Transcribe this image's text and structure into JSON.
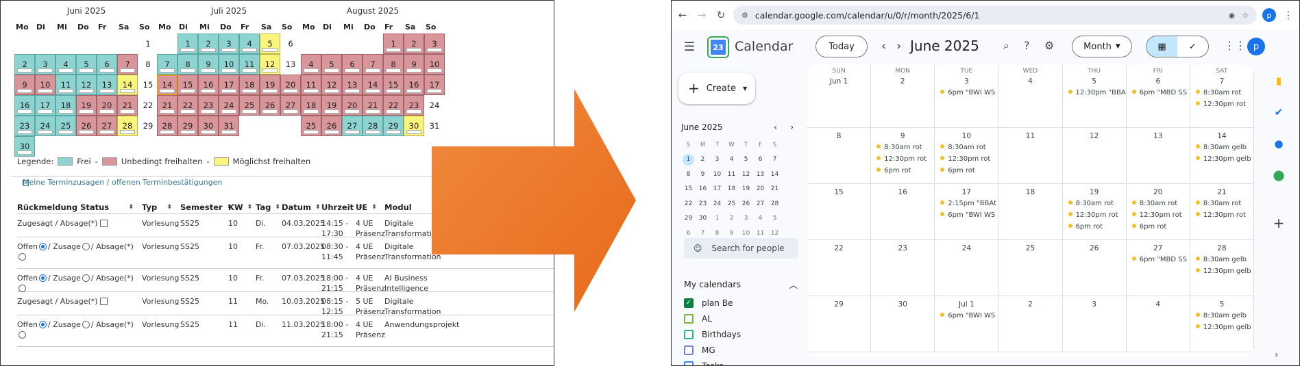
{
  "left": {
    "months": [
      {
        "title": "Juni 2025",
        "days": [
          "Mo",
          "Di",
          "Mi",
          "Do",
          "Fr",
          "Sa",
          "So"
        ],
        "cells": [
          {
            "d": "",
            "s": ""
          },
          {
            "d": "",
            "s": ""
          },
          {
            "d": "",
            "s": ""
          },
          {
            "d": "",
            "s": ""
          },
          {
            "d": "",
            "s": ""
          },
          {
            "d": "",
            "s": ""
          },
          {
            "d": "1",
            "s": ""
          },
          {
            "d": "2",
            "s": "f"
          },
          {
            "d": "3",
            "s": "f"
          },
          {
            "d": "4",
            "s": "f"
          },
          {
            "d": "5",
            "s": "f"
          },
          {
            "d": "6",
            "s": "f"
          },
          {
            "d": "7",
            "s": "u"
          },
          {
            "d": "8",
            "s": ""
          },
          {
            "d": "9",
            "s": "u"
          },
          {
            "d": "10",
            "s": "u"
          },
          {
            "d": "11",
            "s": "f"
          },
          {
            "d": "12",
            "s": "f"
          },
          {
            "d": "13",
            "s": "f"
          },
          {
            "d": "14",
            "s": "m"
          },
          {
            "d": "15",
            "s": ""
          },
          {
            "d": "16",
            "s": "f"
          },
          {
            "d": "17",
            "s": "f"
          },
          {
            "d": "18",
            "s": "f"
          },
          {
            "d": "19",
            "s": "u"
          },
          {
            "d": "20",
            "s": "u"
          },
          {
            "d": "21",
            "s": "u"
          },
          {
            "d": "22",
            "s": ""
          },
          {
            "d": "23",
            "s": "f"
          },
          {
            "d": "24",
            "s": "f"
          },
          {
            "d": "25",
            "s": "f"
          },
          {
            "d": "26",
            "s": "u"
          },
          {
            "d": "27",
            "s": "u"
          },
          {
            "d": "28",
            "s": "m"
          },
          {
            "d": "29",
            "s": ""
          },
          {
            "d": "30",
            "s": "f"
          }
        ]
      },
      {
        "title": "Juli 2025",
        "days": [
          "Mo",
          "Di",
          "Mi",
          "Do",
          "Fr",
          "Sa",
          "So"
        ],
        "cells": [
          {
            "d": "",
            "s": ""
          },
          {
            "d": "1",
            "s": "f"
          },
          {
            "d": "2",
            "s": "f"
          },
          {
            "d": "3",
            "s": "f"
          },
          {
            "d": "4",
            "s": "f"
          },
          {
            "d": "5",
            "s": "m"
          },
          {
            "d": "6",
            "s": ""
          },
          {
            "d": "7",
            "s": "f"
          },
          {
            "d": "8",
            "s": "f"
          },
          {
            "d": "9",
            "s": "f"
          },
          {
            "d": "10",
            "s": "f"
          },
          {
            "d": "11",
            "s": "f"
          },
          {
            "d": "12",
            "s": "m"
          },
          {
            "d": "13",
            "s": ""
          },
          {
            "d": "14",
            "s": "u",
            "sel": true
          },
          {
            "d": "15",
            "s": "u"
          },
          {
            "d": "16",
            "s": "u"
          },
          {
            "d": "17",
            "s": "u"
          },
          {
            "d": "18",
            "s": "u"
          },
          {
            "d": "19",
            "s": "u"
          },
          {
            "d": "20",
            "s": "u"
          },
          {
            "d": "21",
            "s": "u"
          },
          {
            "d": "22",
            "s": "u"
          },
          {
            "d": "23",
            "s": "u"
          },
          {
            "d": "24",
            "s": "u"
          },
          {
            "d": "25",
            "s": "u"
          },
          {
            "d": "26",
            "s": "u"
          },
          {
            "d": "27",
            "s": "u"
          },
          {
            "d": "28",
            "s": "u"
          },
          {
            "d": "29",
            "s": "u"
          },
          {
            "d": "30",
            "s": "u"
          },
          {
            "d": "31",
            "s": "u"
          }
        ]
      },
      {
        "title": "August 2025",
        "days": [
          "Mo",
          "Di",
          "Mi",
          "Do",
          "Fr",
          "Sa",
          "So"
        ],
        "cells": [
          {
            "d": "",
            "s": ""
          },
          {
            "d": "",
            "s": ""
          },
          {
            "d": "",
            "s": ""
          },
          {
            "d": "",
            "s": ""
          },
          {
            "d": "1",
            "s": "u"
          },
          {
            "d": "2",
            "s": "u"
          },
          {
            "d": "3",
            "s": "u"
          },
          {
            "d": "4",
            "s": "u"
          },
          {
            "d": "5",
            "s": "u"
          },
          {
            "d": "6",
            "s": "u"
          },
          {
            "d": "7",
            "s": "u"
          },
          {
            "d": "8",
            "s": "u"
          },
          {
            "d": "9",
            "s": "u"
          },
          {
            "d": "10",
            "s": "u"
          },
          {
            "d": "11",
            "s": "u"
          },
          {
            "d": "12",
            "s": "u"
          },
          {
            "d": "13",
            "s": "u"
          },
          {
            "d": "14",
            "s": "u"
          },
          {
            "d": "15",
            "s": "u"
          },
          {
            "d": "16",
            "s": "u"
          },
          {
            "d": "17",
            "s": "u"
          },
          {
            "d": "18",
            "s": "u"
          },
          {
            "d": "19",
            "s": "u"
          },
          {
            "d": "20",
            "s": "u"
          },
          {
            "d": "21",
            "s": "u"
          },
          {
            "d": "22",
            "s": "u"
          },
          {
            "d": "23",
            "s": "u"
          },
          {
            "d": "24",
            "s": ""
          },
          {
            "d": "25",
            "s": "u"
          },
          {
            "d": "26",
            "s": "u"
          },
          {
            "d": "27",
            "s": "f"
          },
          {
            "d": "28",
            "s": "f"
          },
          {
            "d": "29",
            "s": "f"
          },
          {
            "d": "30",
            "s": "m"
          },
          {
            "d": "31",
            "s": ""
          }
        ]
      }
    ],
    "legend": {
      "label": "Legende:",
      "frei": "Frei",
      "unbedingt": "Unbedingt freihalten",
      "moeglichst": "Möglichst freihalten",
      "sep": "-",
      "colors": {
        "frei": "#8dd3d0",
        "unbedingt": "#d8959a",
        "moeglichst": "#fbf57e"
      }
    },
    "section_title": "Meine Terminzusagen / offenen Terminbestätigungen",
    "table": {
      "headers": [
        "Rückmeldung Status",
        "Typ",
        "Semester",
        "KW",
        "Tag",
        "Datum",
        "Uhrzeit",
        "UE",
        "Modul"
      ],
      "rows": [
        {
          "status_type": "zugesagt",
          "status": "Zugesagt / Absage(*)",
          "typ": "Vorlesung",
          "semester": "SS25",
          "kw": "10",
          "tag": "Di.",
          "datum": "04.03.2025",
          "zeit1": "14:15 -",
          "zeit2": "17:30",
          "ue1": "4 UE",
          "ue2": "Präsenz",
          "modul1": "Digitale",
          "modul2": "Transformation"
        },
        {
          "status_type": "offen",
          "offen": "Offen",
          "zusage": "/ Zusage",
          "absage": "/ Absage(*)",
          "typ": "Vorlesung",
          "semester": "SS25",
          "kw": "10",
          "tag": "Fr.",
          "datum": "07.03.2025",
          "zeit1": "08:30 -",
          "zeit2": "11:45",
          "ue1": "4 UE",
          "ue2": "Präsenz",
          "modul1": "Digitale",
          "modul2": "Transformation"
        },
        {
          "status_type": "offen",
          "offen": "Offen",
          "zusage": "/ Zusage",
          "absage": "/ Absage(*)",
          "typ": "Vorlesung",
          "semester": "SS25",
          "kw": "10",
          "tag": "Fr.",
          "datum": "07.03.2025",
          "zeit1": "18:00 -",
          "zeit2": "21:15",
          "ue1": "4 UE",
          "ue2": "Präsenz",
          "modul1": "AI Business",
          "modul2": "Intelligence"
        },
        {
          "status_type": "zugesagt",
          "status": "Zugesagt / Absage(*)",
          "typ": "Vorlesung",
          "semester": "SS25",
          "kw": "11",
          "tag": "Mo.",
          "datum": "10.03.2025",
          "zeit1": "08:15 -",
          "zeit2": "12:15",
          "ue1": "5 UE",
          "ue2": "Präsenz",
          "modul1": "Digitale",
          "modul2": "Transformation"
        },
        {
          "status_type": "offen",
          "offen": "Offen",
          "zusage": "/ Zusage",
          "absage": "/ Absage(*)",
          "typ": "Vorlesung",
          "semester": "SS25",
          "kw": "11",
          "tag": "Di.",
          "datum": "11.03.2025",
          "zeit1": "18:00 -",
          "zeit2": "21:15",
          "ue1": "4 UE",
          "ue2": "Präsenz",
          "modul1": "Anwendungsprojekt",
          "modul2": ""
        }
      ]
    }
  },
  "arrow_color": "#ee7b2f",
  "right": {
    "url": "calendar.google.com/calendar/u/0/r/month/2025/6/1",
    "profile_initial": "p",
    "app_name": "Calendar",
    "logo_text": "23",
    "today_label": "Today",
    "current_month": "June 2025",
    "view_label": "Month",
    "create_label": "Create",
    "mini": {
      "title": "June 2025",
      "dows": [
        "S",
        "M",
        "T",
        "W",
        "T",
        "F",
        "S"
      ],
      "days": [
        {
          "d": "1",
          "c": "today"
        },
        {
          "d": "2"
        },
        {
          "d": "3"
        },
        {
          "d": "4"
        },
        {
          "d": "5"
        },
        {
          "d": "6"
        },
        {
          "d": "7"
        },
        {
          "d": "8"
        },
        {
          "d": "9"
        },
        {
          "d": "10"
        },
        {
          "d": "11"
        },
        {
          "d": "12"
        },
        {
          "d": "13"
        },
        {
          "d": "14"
        },
        {
          "d": "15"
        },
        {
          "d": "16"
        },
        {
          "d": "17"
        },
        {
          "d": "18"
        },
        {
          "d": "19"
        },
        {
          "d": "20"
        },
        {
          "d": "21"
        },
        {
          "d": "22"
        },
        {
          "d": "23"
        },
        {
          "d": "24"
        },
        {
          "d": "25"
        },
        {
          "d": "26"
        },
        {
          "d": "27"
        },
        {
          "d": "28"
        },
        {
          "d": "29"
        },
        {
          "d": "30"
        },
        {
          "d": "1",
          "c": "dim"
        },
        {
          "d": "2",
          "c": "dim"
        },
        {
          "d": "3",
          "c": "dim"
        },
        {
          "d": "4",
          "c": "dim"
        },
        {
          "d": "5",
          "c": "dim"
        },
        {
          "d": "6",
          "c": "dim"
        },
        {
          "d": "7",
          "c": "dim"
        },
        {
          "d": "8",
          "c": "dim"
        },
        {
          "d": "9",
          "c": "dim"
        },
        {
          "d": "10",
          "c": "dim"
        },
        {
          "d": "11",
          "c": "dim"
        },
        {
          "d": "12",
          "c": "dim"
        }
      ]
    },
    "search_people": "Search for people",
    "my_calendars_label": "My calendars",
    "calendars": [
      {
        "name": "plan Be",
        "checked": true,
        "color": "#0b8043"
      },
      {
        "name": "AL",
        "checked": false,
        "color": "#7cb342"
      },
      {
        "name": "Birthdays",
        "checked": false,
        "color": "#33b679"
      },
      {
        "name": "MG",
        "checked": false,
        "color": "#7986cb"
      },
      {
        "name": "Tasks",
        "checked": false,
        "color": "#4285f4"
      }
    ],
    "weekday_headers": [
      "SUN",
      "MON",
      "TUE",
      "WED",
      "THU",
      "FRI",
      "SAT"
    ],
    "weeks": [
      [
        {
          "d": "Jun 1",
          "ev": []
        },
        {
          "d": "2",
          "ev": []
        },
        {
          "d": "3",
          "ev": [
            "6pm \"BWI WS"
          ]
        },
        {
          "d": "4",
          "ev": []
        },
        {
          "d": "5",
          "ev": [
            "12:30pm \"BBA"
          ]
        },
        {
          "d": "6",
          "ev": [
            "6pm \"MBD SS"
          ]
        },
        {
          "d": "7",
          "ev": [
            "8:30am rot",
            "12:30pm rot"
          ]
        }
      ],
      [
        {
          "d": "8",
          "ev": []
        },
        {
          "d": "9",
          "ev": [
            "8:30am rot",
            "12:30pm rot",
            "6pm rot"
          ]
        },
        {
          "d": "10",
          "ev": [
            "8:30am rot",
            "12:30pm rot",
            "6pm rot"
          ]
        },
        {
          "d": "11",
          "ev": []
        },
        {
          "d": "12",
          "ev": []
        },
        {
          "d": "13",
          "ev": []
        },
        {
          "d": "14",
          "ev": [
            "8:30am gelb",
            "12:30pm gelb"
          ]
        }
      ],
      [
        {
          "d": "15",
          "ev": []
        },
        {
          "d": "16",
          "ev": []
        },
        {
          "d": "17",
          "ev": [
            "2:15pm \"BBAt",
            "6pm \"BWI WS"
          ]
        },
        {
          "d": "18",
          "ev": []
        },
        {
          "d": "19",
          "ev": [
            "8:30am rot",
            "12:30pm rot",
            "6pm rot"
          ]
        },
        {
          "d": "20",
          "ev": [
            "8:30am rot",
            "12:30pm rot",
            "6pm rot"
          ]
        },
        {
          "d": "21",
          "ev": [
            "8:30am rot",
            "12:30pm rot"
          ]
        }
      ],
      [
        {
          "d": "22",
          "ev": []
        },
        {
          "d": "23",
          "ev": []
        },
        {
          "d": "24",
          "ev": []
        },
        {
          "d": "25",
          "ev": []
        },
        {
          "d": "26",
          "ev": []
        },
        {
          "d": "27",
          "ev": [
            "6pm \"MBD SS"
          ]
        },
        {
          "d": "28",
          "ev": [
            "8:30am gelb",
            "12:30pm gelb"
          ]
        }
      ],
      [
        {
          "d": "29",
          "ev": []
        },
        {
          "d": "30",
          "ev": []
        },
        {
          "d": "Jul 1",
          "ev": [
            "6pm \"BWI WS"
          ]
        },
        {
          "d": "2",
          "ev": []
        },
        {
          "d": "3",
          "ev": []
        },
        {
          "d": "4",
          "ev": []
        },
        {
          "d": "5",
          "ev": [
            "8:30am gelb",
            "12:30pm gelb"
          ]
        }
      ]
    ],
    "side_icons": [
      {
        "name": "keep-icon",
        "glyph": "▮",
        "color": "#fbbc04"
      },
      {
        "name": "tasks-icon",
        "glyph": "✔",
        "color": "#1a73e8"
      },
      {
        "name": "contacts-icon",
        "glyph": "●",
        "color": "#1a73e8"
      },
      {
        "name": "maps-icon",
        "glyph": "⬤",
        "color": "#34a853"
      },
      {
        "name": "add-addon-icon",
        "glyph": "+",
        "color": "#444"
      }
    ]
  }
}
